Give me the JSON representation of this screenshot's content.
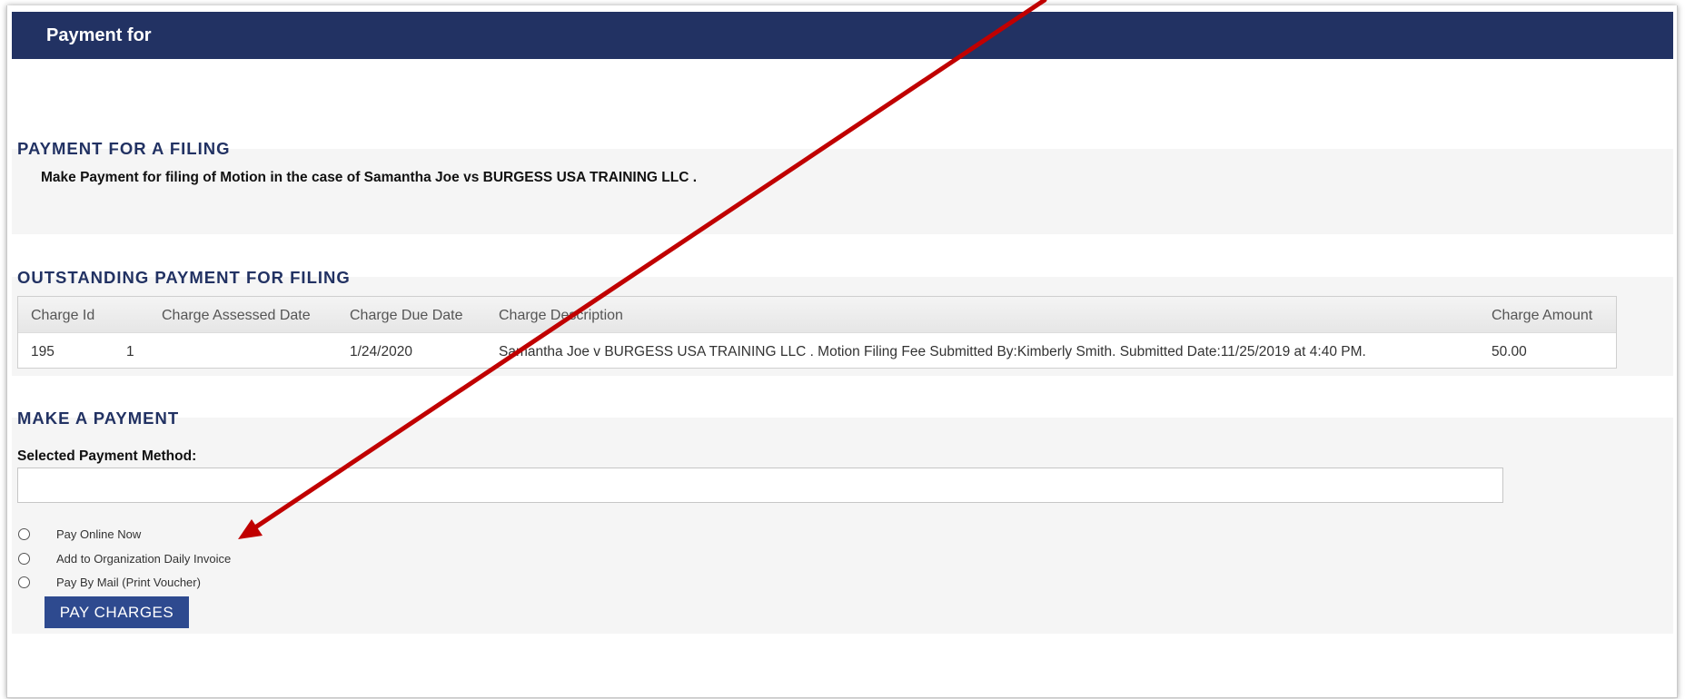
{
  "header": {
    "title": "Payment for"
  },
  "filing_section": {
    "heading": "PAYMENT FOR A FILING",
    "description": "Make Payment for filing of Motion in the case of Samantha Joe vs BURGESS USA TRAINING LLC ."
  },
  "outstanding_section": {
    "heading": "OUTSTANDING PAYMENT FOR FILING",
    "columns": [
      "Charge Id",
      "Charge Assessed Date",
      "Charge Due Date",
      "Charge Description",
      "Charge Amount"
    ],
    "rows": [
      {
        "charge_id": "195",
        "extra": "1",
        "assessed_date": "",
        "due_date": "1/24/2020",
        "description": "Samantha Joe v BURGESS USA TRAINING LLC . Motion Filing Fee Submitted By:Kimberly Smith. Submitted Date:11/25/2019 at 4:40 PM.",
        "amount": "50.00"
      }
    ]
  },
  "payment_section": {
    "heading": "MAKE A PAYMENT",
    "method_label": "Selected Payment Method:",
    "method_value": "",
    "options": [
      {
        "label": "Pay Online Now",
        "selected": false
      },
      {
        "label": "Add to Organization Daily Invoice",
        "selected": false
      },
      {
        "label": "Pay By Mail (Print Voucher)",
        "selected": false
      }
    ],
    "submit_label": "PAY CHARGES"
  },
  "colors": {
    "header_bg": "#223263",
    "heading_text": "#223263",
    "button_bg": "#2e4a8f",
    "panel_bg": "#f5f5f5",
    "annotation_arrow": "#c00000"
  }
}
